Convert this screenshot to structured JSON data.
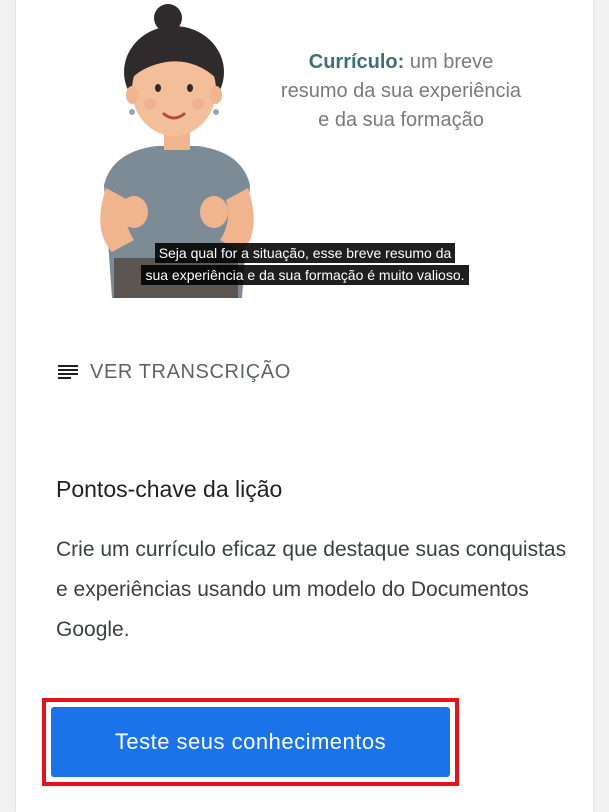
{
  "video": {
    "slide_title_bold": "Currículo:",
    "slide_title_rest": " um breve",
    "slide_line2": "resumo da sua experiência",
    "slide_line3": "e da sua formação",
    "caption_line1": "Seja qual for a situação, esse breve resumo da",
    "caption_line2": "sua experiência e da sua formação é muito valioso."
  },
  "transcript": {
    "icon": "transcript-lines-icon",
    "label": "VER TRANSCRIÇÃO"
  },
  "key_points": {
    "title": "Pontos-chave da lição",
    "body": "Crie um currículo eficaz que destaque suas conquistas e experiências usando um modelo do Documentos Google."
  },
  "cta": {
    "label": "Teste seus conhecimentos"
  },
  "colors": {
    "accent_blue": "#1a73e8",
    "highlight_red": "#e5121c",
    "slide_accent": "#3e6f73"
  }
}
